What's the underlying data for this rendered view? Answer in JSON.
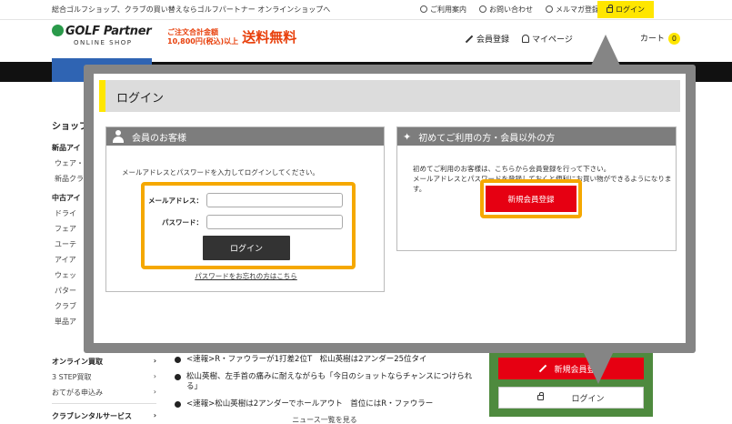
{
  "header": {
    "tagline": "総合ゴルフショップ、クラブの買い替えならゴルフパートナー オンラインショップへ",
    "links": [
      "ご利用案内",
      "お問い合わせ",
      "メルマガ登録"
    ],
    "login": "ログイン",
    "logo_main": "GOLF Partner",
    "logo_sub": "ONLINE SHOP",
    "promo_line1": "ご注文合計金額",
    "promo_line2": "10,800円(税込)以上",
    "promo_big": "送料無料",
    "register": "会員登録",
    "mypage": "マイページ",
    "cart": "カート",
    "cart_count": "0"
  },
  "sidebar": {
    "heading": "ショップ",
    "sec1": "新品アイ",
    "items1": [
      "ウェア・",
      "新品クラ"
    ],
    "sec2": "中古アイ",
    "items2": [
      "ドライ",
      "フェア",
      "ユーテ",
      "アイア",
      "ウェッ",
      "パター",
      "クラブ",
      "単品ア"
    ],
    "bottom": {
      "buy_heading": "オンライン買取",
      "buy_items": [
        "3 STEP買取",
        "おてがる申込み"
      ],
      "rental_heading": "クラブレンタルサービス"
    }
  },
  "news": {
    "items": [
      "<速報>R・ファウラーが1打差2位T　松山英樹は2アンダー25位タイ",
      "松山英樹、左手首の痛みに耐えながらも「今日のショットならチャンスにつけられる」",
      "<速報>松山英樹は2アンダーでホールアウト　首位にはR・ファウラー"
    ],
    "more": "ニュース一覧を見る"
  },
  "side_buttons": {
    "register": "新規会員登録",
    "login": "ログイン"
  },
  "modal": {
    "title": "ログイン",
    "member": {
      "heading": "会員のお客様",
      "description": "メールアドレスとパスワードを入力してログインしてください。",
      "email_label": "メールアドレス：",
      "email_value": "",
      "password_label": "パスワード：",
      "password_value": "",
      "login_button": "ログイン",
      "forgot_link": "パスワードをお忘れの方はこちら"
    },
    "guest": {
      "heading": "初めてご利用の方・会員以外の方",
      "description_line1": "初めてご利用のお客様は、こちらから会員登録を行って下さい。",
      "description_line2": "メールアドレスとパスワードを登録しておくと便利にお買い物ができるようになります。",
      "register_button": "新規会員登録"
    }
  },
  "colors": {
    "highlight": "#f5a800",
    "accent_yellow": "#ffe600",
    "register_red": "#e60012",
    "overlay_gray": "#858585"
  }
}
